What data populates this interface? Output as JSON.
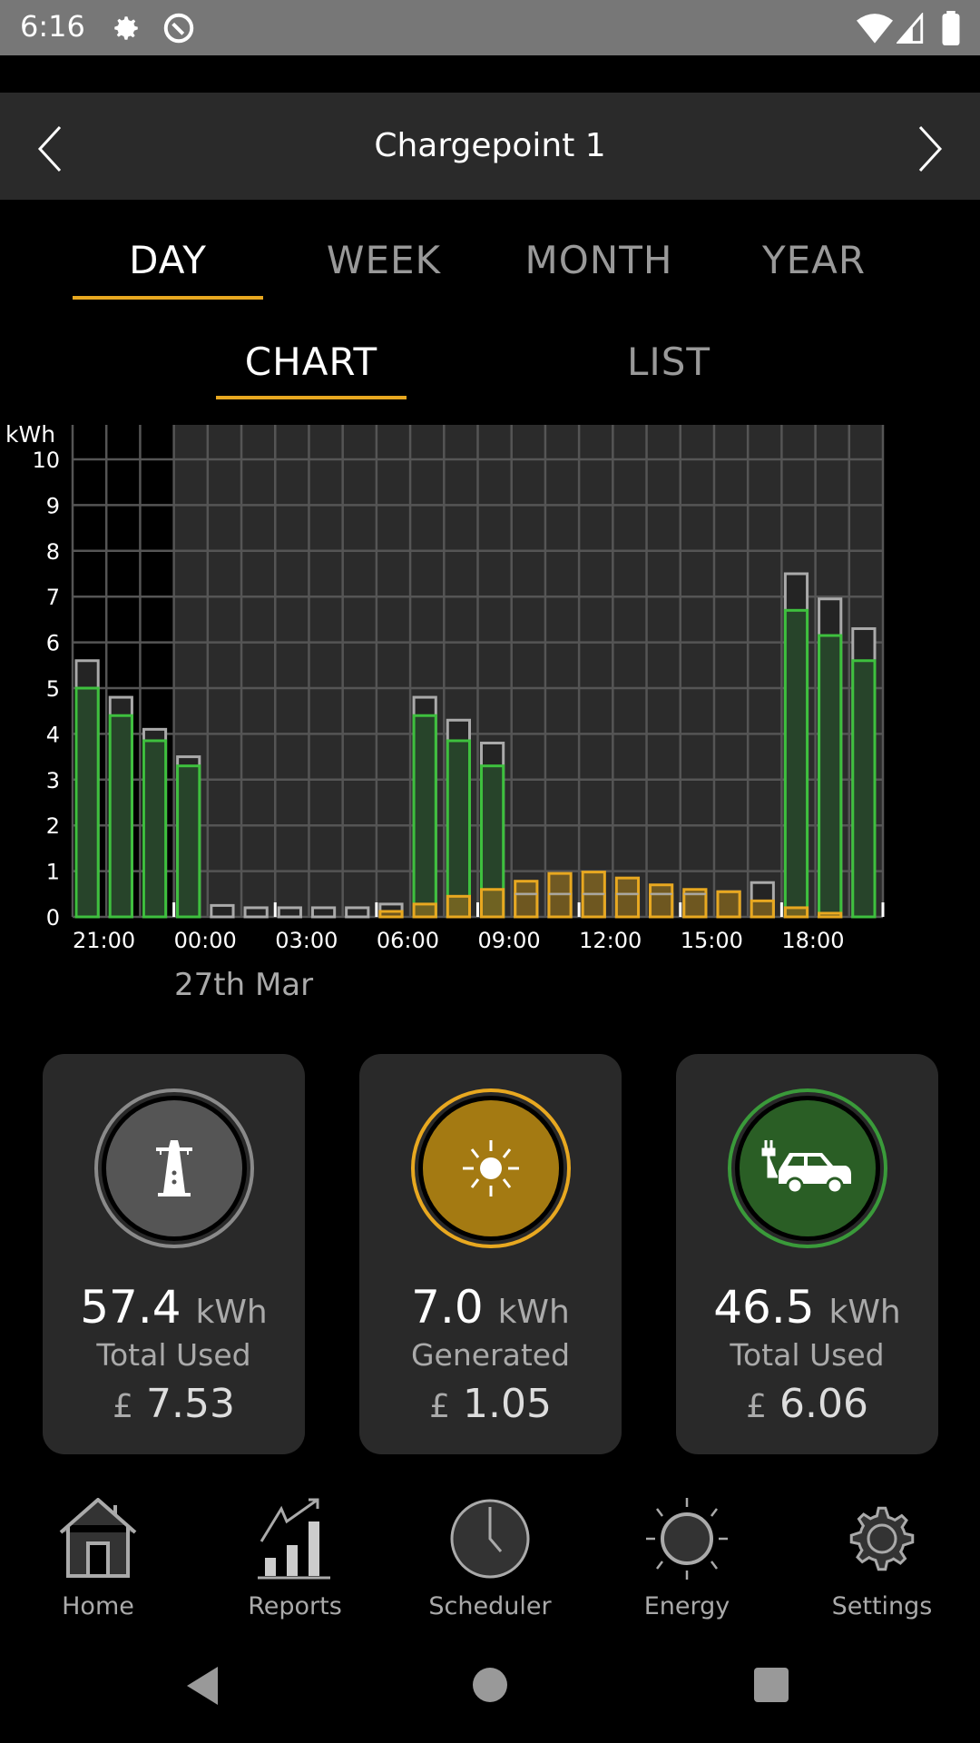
{
  "status_bar": {
    "time": "6:16",
    "icons": [
      "gear-icon",
      "at-sign-icon",
      "wifi-icon",
      "signal-icon",
      "battery-icon"
    ]
  },
  "header": {
    "title": "Chargepoint 1",
    "prev_icon": "chevron-left-icon",
    "next_icon": "chevron-right-icon"
  },
  "period_tabs": [
    {
      "label": "DAY",
      "active": true
    },
    {
      "label": "WEEK",
      "active": false
    },
    {
      "label": "MONTH",
      "active": false
    },
    {
      "label": "YEAR",
      "active": false
    }
  ],
  "view_tabs": [
    {
      "label": "CHART",
      "active": true
    },
    {
      "label": "LIST",
      "active": false
    }
  ],
  "colors": {
    "accent": "#e8a820",
    "grid": "#808080",
    "solar": "#e8a820",
    "ev": "#3ec03e",
    "background": "#000000"
  },
  "chart_data": {
    "type": "bar",
    "ylabel": "kWh",
    "ylim": [
      0,
      10
    ],
    "yticks": [
      "0",
      "1",
      "2",
      "3",
      "4",
      "5",
      "6",
      "7",
      "8",
      "9",
      "10"
    ],
    "xtick_labels": [
      "21:00",
      "00:00",
      "03:00",
      "06:00",
      "09:00",
      "12:00",
      "15:00",
      "18:00"
    ],
    "date_label": "27th Mar",
    "categories": [
      "21:00",
      "22:00",
      "23:00",
      "00:00",
      "01:00",
      "02:00",
      "03:00",
      "04:00",
      "05:00",
      "06:00",
      "07:00",
      "08:00",
      "09:00",
      "10:00",
      "11:00",
      "12:00",
      "13:00",
      "14:00",
      "15:00",
      "16:00",
      "17:00",
      "18:00",
      "19:00",
      "20:00"
    ],
    "series": [
      {
        "key": "total",
        "values": [
          5.6,
          4.8,
          4.1,
          3.5,
          0.25,
          0.2,
          0.2,
          0.2,
          0.2,
          0.28,
          4.8,
          4.3,
          3.8,
          0.5,
          0.5,
          0.5,
          0.5,
          0.5,
          0.5,
          0.55,
          0.75,
          7.5,
          6.95,
          6.3
        ]
      },
      {
        "key": "ev",
        "values": [
          5.0,
          4.4,
          3.85,
          3.3,
          0,
          0,
          0,
          0,
          0,
          0,
          4.4,
          3.85,
          3.3,
          0,
          0,
          0,
          0,
          0,
          0,
          0,
          0,
          6.7,
          6.15,
          5.6
        ]
      },
      {
        "key": "solar",
        "values": [
          0,
          0,
          0,
          0,
          0,
          0,
          0,
          0,
          0,
          0.12,
          0.28,
          0.45,
          0.6,
          0.78,
          0.95,
          0.98,
          0.85,
          0.7,
          0.6,
          0.55,
          0.35,
          0.2,
          0.08,
          0
        ]
      }
    ]
  },
  "cards": [
    {
      "icon": "pylon-icon",
      "value": "57.4",
      "unit": "kWh",
      "label": "Total Used",
      "currency": "£",
      "price": "7.53",
      "ring": "#8a8a8a",
      "fill": "#555555"
    },
    {
      "icon": "sun-icon",
      "value": "7.0",
      "unit": "kWh",
      "label": "Generated",
      "currency": "£",
      "price": "1.05",
      "ring": "#e8a820",
      "fill": "#a47a12"
    },
    {
      "icon": "ev-car-icon",
      "value": "46.5",
      "unit": "kWh",
      "label": "Total Used",
      "currency": "£",
      "price": "6.06",
      "ring": "#3a9a3a",
      "fill": "#2a5e25"
    }
  ],
  "bottom_nav": [
    {
      "label": "Home",
      "icon": "home-icon"
    },
    {
      "label": "Reports",
      "icon": "reports-icon"
    },
    {
      "label": "Scheduler",
      "icon": "clock-icon"
    },
    {
      "label": "Energy",
      "icon": "sun-icon"
    },
    {
      "label": "Settings",
      "icon": "gear-icon"
    }
  ],
  "system_nav": [
    "back-icon",
    "home-circle-icon",
    "recents-icon"
  ]
}
